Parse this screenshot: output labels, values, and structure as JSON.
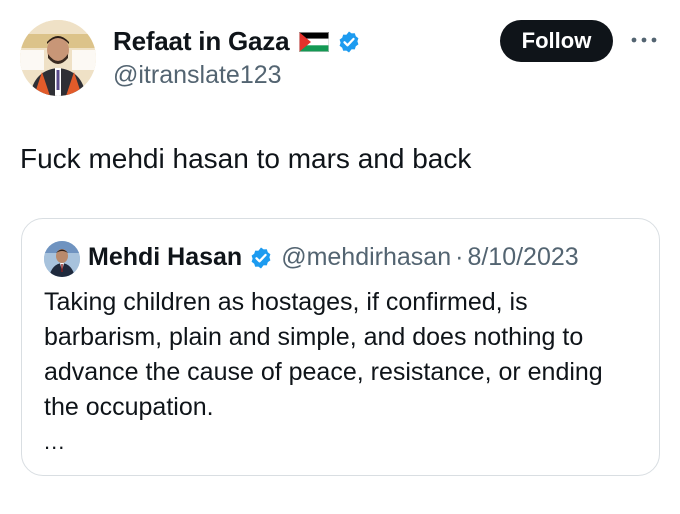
{
  "author": {
    "display_name": "Refaat in Gaza",
    "flag_icon": "palestine-flag-icon",
    "verified_icon": "verified-badge-icon",
    "handle": "@itranslate123",
    "avatar_icon": "profile-avatar"
  },
  "actions": {
    "follow_label": "Follow",
    "more_icon": "more-options-icon"
  },
  "tweet": {
    "text": "Fuck mehdi hasan to mars and back"
  },
  "quoted_tweet": {
    "display_name": "Mehdi Hasan",
    "verified_icon": "verified-badge-icon",
    "handle": "@mehdirhasan",
    "separator": "·",
    "date": "8/10/2023",
    "text_lines": [
      "Taking children as hostages, if confirmed, is",
      "barbarism, plain and simple, and does nothing to",
      "advance the cause of peace, resistance, or ending",
      "the occupation."
    ],
    "ellipsis": "..."
  },
  "colors": {
    "text_primary": "#0f1419",
    "text_secondary": "#536471",
    "verified_blue": "#1d9bf0",
    "border": "#d9dee2",
    "button_bg": "#0f1419"
  }
}
